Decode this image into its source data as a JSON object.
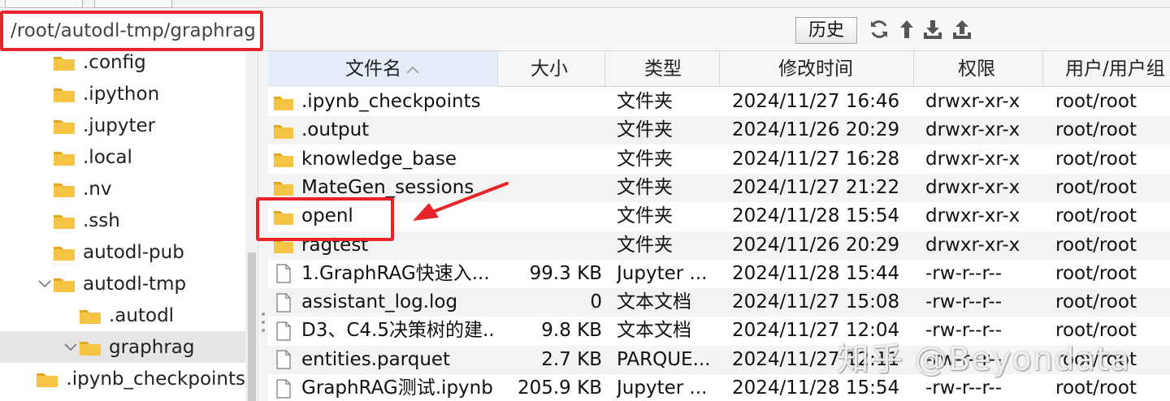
{
  "path": {
    "value": "/root/autodl-tmp/graphrag"
  },
  "toolbar": {
    "history_label": "历史",
    "icons": [
      "refresh-icon",
      "upload-arrow-icon",
      "download-icon",
      "upload-tray-icon"
    ]
  },
  "tree": {
    "items": [
      {
        "label": ".config",
        "depth": 2,
        "expanded": null
      },
      {
        "label": ".ipython",
        "depth": 2,
        "expanded": null
      },
      {
        "label": ".jupyter",
        "depth": 2,
        "expanded": null
      },
      {
        "label": ".local",
        "depth": 2,
        "expanded": null
      },
      {
        "label": ".nv",
        "depth": 2,
        "expanded": null
      },
      {
        "label": ".ssh",
        "depth": 2,
        "expanded": null
      },
      {
        "label": "autodl-pub",
        "depth": 2,
        "expanded": null
      },
      {
        "label": "autodl-tmp",
        "depth": 2,
        "expanded": true
      },
      {
        "label": ".autodl",
        "depth": 3,
        "expanded": null
      },
      {
        "label": "graphrag",
        "depth": 3,
        "expanded": true,
        "selected": true
      },
      {
        "label": ".ipynb_checkpoints",
        "depth": 4,
        "expanded": null
      }
    ]
  },
  "table": {
    "columns": {
      "name": "文件名",
      "size": "大小",
      "type": "类型",
      "modified": "修改时间",
      "perm": "权限",
      "owner": "用户/用户组"
    },
    "sort_column": "name",
    "rows": [
      {
        "kind": "folder",
        "name": ".ipynb_checkpoints",
        "size": "",
        "type": "文件夹",
        "modified": "2024/11/27 16:46",
        "perm": "drwxr-xr-x",
        "owner": "root/root"
      },
      {
        "kind": "folder",
        "name": ".output",
        "size": "",
        "type": "文件夹",
        "modified": "2024/11/26 20:29",
        "perm": "drwxr-xr-x",
        "owner": "root/root"
      },
      {
        "kind": "folder",
        "name": "knowledge_base",
        "size": "",
        "type": "文件夹",
        "modified": "2024/11/27 16:28",
        "perm": "drwxr-xr-x",
        "owner": "root/root"
      },
      {
        "kind": "folder",
        "name": "MateGen_sessions",
        "size": "",
        "type": "文件夹",
        "modified": "2024/11/27 21:22",
        "perm": "drwxr-xr-x",
        "owner": "root/root"
      },
      {
        "kind": "folder",
        "name": "openl",
        "size": "",
        "type": "文件夹",
        "modified": "2024/11/28 15:54",
        "perm": "drwxr-xr-x",
        "owner": "root/root"
      },
      {
        "kind": "folder",
        "name": "ragtest",
        "size": "",
        "type": "文件夹",
        "modified": "2024/11/26 20:29",
        "perm": "drwxr-xr-x",
        "owner": "root/root"
      },
      {
        "kind": "file",
        "name": "1.GraphRAG快速入...",
        "size": "99.3 KB",
        "type": "Jupyter ...",
        "modified": "2024/11/28 15:44",
        "perm": "-rw-r--r--",
        "owner": "root/root"
      },
      {
        "kind": "file",
        "name": "assistant_log.log",
        "size": "0",
        "type": "文本文档",
        "modified": "2024/11/27 15:08",
        "perm": "-rw-r--r--",
        "owner": "root/root"
      },
      {
        "kind": "file",
        "name": "D3、C4.5决策树的建...",
        "size": "9.8 KB",
        "type": "文本文档",
        "modified": "2024/11/27 12:04",
        "perm": "-rw-r--r--",
        "owner": "root/root"
      },
      {
        "kind": "file",
        "name": "entities.parquet",
        "size": "2.7 KB",
        "type": "PARQUE...",
        "modified": "2024/11/27 12:11",
        "perm": "-rw-r--r--",
        "owner": "root/root"
      },
      {
        "kind": "file",
        "name": "GraphRAG测试.ipynb",
        "size": "205.9 KB",
        "type": "Jupyter ...",
        "modified": "2024/11/28 15:54",
        "perm": "-rw-r--r--",
        "owner": "root/root"
      }
    ]
  },
  "colors": {
    "annotation": "#e8232a",
    "folder": "#f6c445",
    "folder_dark": "#e0a81f"
  },
  "watermark": "知乎 @Beyondata"
}
